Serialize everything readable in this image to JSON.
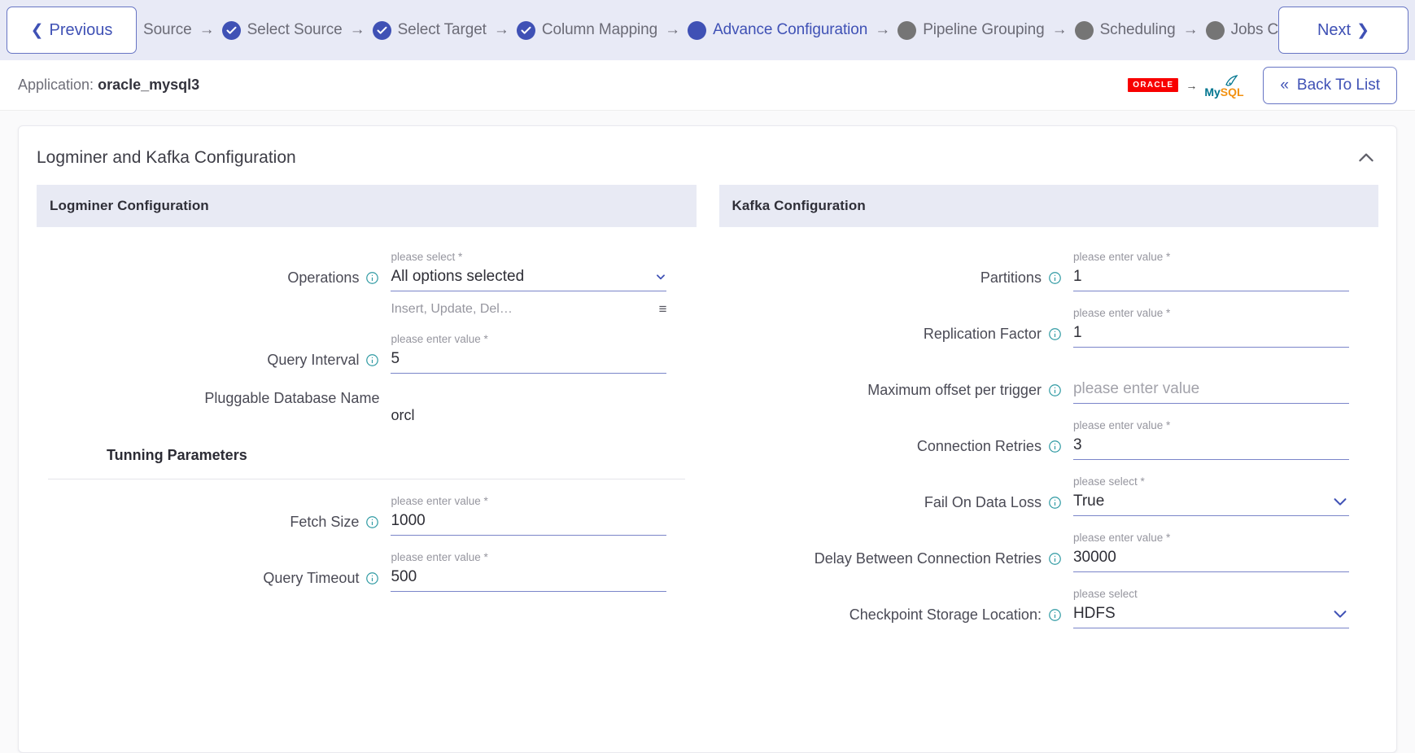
{
  "stepper": {
    "previous_label": "Previous",
    "next_label": "Next",
    "prev_chevron": "chevron-left-icon",
    "next_chevron": "chevron-right-icon",
    "steps": [
      {
        "label": "Source",
        "state": "truncated"
      },
      {
        "label": "Select Source",
        "state": "done"
      },
      {
        "label": "Select Target",
        "state": "done"
      },
      {
        "label": "Column Mapping",
        "state": "done"
      },
      {
        "label": "Advance Configuration",
        "state": "current"
      },
      {
        "label": "Pipeline Grouping",
        "state": "pending"
      },
      {
        "label": "Scheduling",
        "state": "pending"
      },
      {
        "label": "Jobs Configura",
        "state": "pending"
      }
    ],
    "arrow_glyph": "→",
    "colors": {
      "done": "#3f51b5",
      "current": "#3f51b5",
      "pending": "#757575",
      "bar_bg": "#e8eaf6"
    }
  },
  "app_header": {
    "label": "Application:",
    "name": "oracle_mysql3",
    "source_logo": "ORACLE",
    "logo_arrow": "→",
    "target_logo_my": "My",
    "target_logo_sql": "SQL",
    "back_label": "Back To List",
    "back_chevron": "double-chevron-left-icon"
  },
  "card": {
    "title": "Logminer and Kafka Configuration",
    "collapse_icon": "chevron-up-icon"
  },
  "logminer": {
    "section_title": "Logminer Configuration",
    "subsection_title": "Tunning Parameters",
    "fields": [
      {
        "label": "Operations",
        "float_label": "please select *",
        "value": "All options selected",
        "type": "multiselect",
        "sub_text": "Insert, Update, Del…",
        "sub_icon": "list-icon"
      },
      {
        "label": "Query Interval",
        "float_label": "please enter value *",
        "value": "5",
        "type": "text"
      },
      {
        "label": "Pluggable Database Name",
        "value": "orcl",
        "type": "static"
      },
      {
        "label": "Fetch Size",
        "float_label": "please enter value *",
        "value": "1000",
        "type": "text"
      },
      {
        "label": "Query Timeout",
        "float_label": "please enter value *",
        "value": "500",
        "type": "text"
      }
    ]
  },
  "kafka": {
    "section_title": "Kafka Configuration",
    "fields": [
      {
        "label": "Partitions",
        "float_label": "please enter value *",
        "value": "1",
        "type": "text"
      },
      {
        "label": "Replication Factor",
        "float_label": "please enter value *",
        "value": "1",
        "type": "text"
      },
      {
        "label": "Maximum offset per trigger",
        "float_label": "",
        "value": "",
        "placeholder": "please enter value",
        "type": "text"
      },
      {
        "label": "Connection Retries",
        "float_label": "please enter value *",
        "value": "3",
        "type": "text"
      },
      {
        "label": "Fail On Data Loss",
        "float_label": "please select *",
        "value": "True",
        "type": "select"
      },
      {
        "label": "Delay Between Connection Retries",
        "float_label": "please enter value *",
        "value": "30000",
        "type": "text"
      },
      {
        "label": "Checkpoint Storage Location:",
        "float_label": "please select",
        "value": "HDFS",
        "type": "select"
      }
    ]
  }
}
